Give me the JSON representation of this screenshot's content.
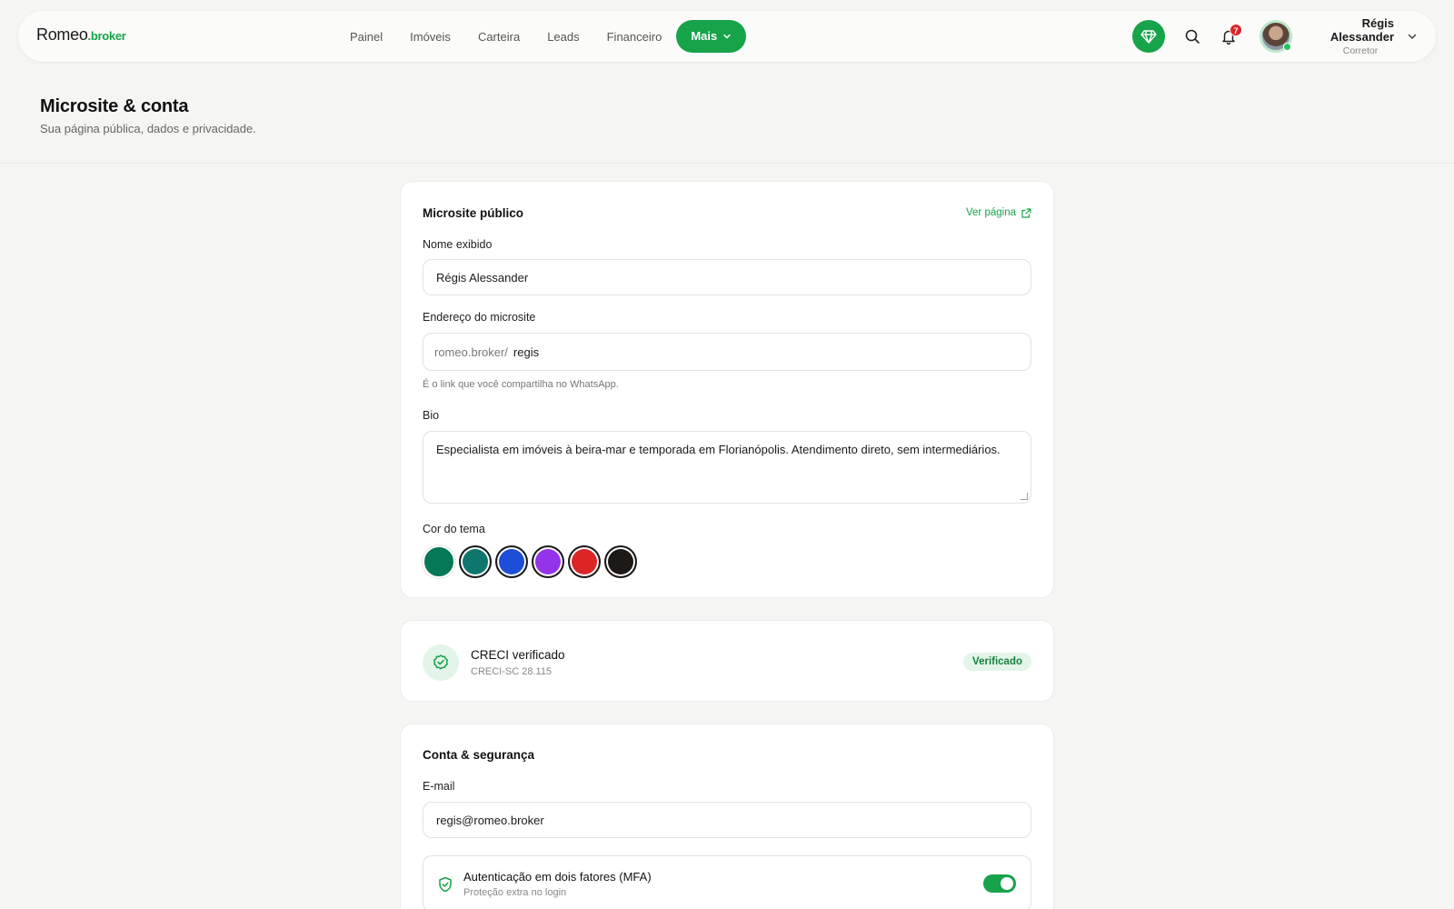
{
  "brand": {
    "name": "Romeo",
    "suffix": ".broker",
    "accent_color": "#16a34a"
  },
  "nav": {
    "items": [
      "Painel",
      "Imóveis",
      "Carteira",
      "Leads",
      "Financeiro"
    ],
    "more_label": "Mais"
  },
  "toolbar": {
    "gem_icon": "gem-icon",
    "search_icon": "search-icon",
    "bell_icon": "bell-icon",
    "notification_count": "7"
  },
  "user": {
    "name": "Régis Alessander",
    "role": "Corretor"
  },
  "page": {
    "title": "Microsite & conta",
    "subtitle": "Sua página pública, dados e privacidade."
  },
  "microsite": {
    "title": "Microsite público",
    "view_link": "Ver página",
    "name_label": "Nome exibido",
    "name_value": "Régis Alessander",
    "address_label": "Endereço do microsite",
    "address_prefix": "romeo.broker/",
    "address_value": "regis",
    "address_hint": "É o link que você compartilha no WhatsApp.",
    "bio_label": "Bio",
    "bio_value": "Especialista em imóveis à beira-mar e temporada em Florianópolis. Atendimento direto, sem intermediários.",
    "theme_label": "Cor do tema",
    "theme_colors": [
      "#047857",
      "#0f766e",
      "#1d4ed8",
      "#9333ea",
      "#dc2626",
      "#1c1917"
    ],
    "selected_theme": 0
  },
  "creci": {
    "title": "CRECI verificado",
    "number": "CRECI-SC 28.115",
    "badge": "Verificado"
  },
  "account": {
    "title": "Conta & segurança",
    "email_label": "E-mail",
    "email_value": "regis@romeo.broker",
    "mfa_title": "Autenticação em dois fatores (MFA)",
    "mfa_subtitle": "Proteção extra no login",
    "mfa_enabled": true
  }
}
